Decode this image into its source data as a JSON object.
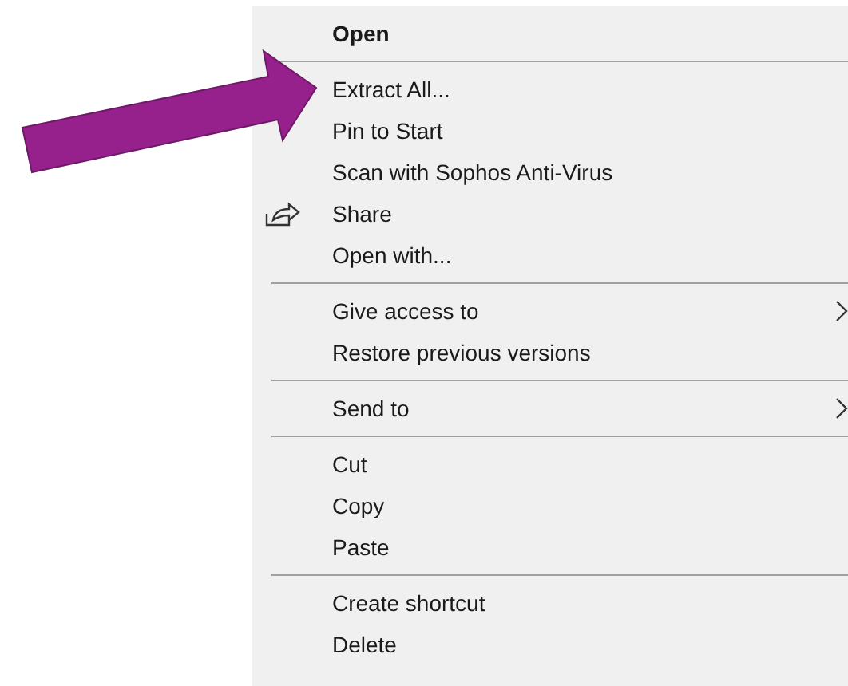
{
  "menu": {
    "items": [
      {
        "kind": "default_bold",
        "label": "Open"
      },
      {
        "kind": "separator"
      },
      {
        "kind": "default",
        "label": "Extract All..."
      },
      {
        "kind": "default",
        "label": "Pin to Start"
      },
      {
        "kind": "default",
        "label": "Scan with Sophos Anti-Virus"
      },
      {
        "kind": "share",
        "label": "Share"
      },
      {
        "kind": "default",
        "label": "Open with..."
      },
      {
        "kind": "separator"
      },
      {
        "kind": "submenu",
        "label": "Give access to"
      },
      {
        "kind": "default",
        "label": "Restore previous versions"
      },
      {
        "kind": "separator"
      },
      {
        "kind": "submenu",
        "label": "Send to"
      },
      {
        "kind": "separator"
      },
      {
        "kind": "default",
        "label": "Cut"
      },
      {
        "kind": "default",
        "label": "Copy"
      },
      {
        "kind": "default",
        "label": "Paste"
      },
      {
        "kind": "separator"
      },
      {
        "kind": "default",
        "label": "Create shortcut"
      },
      {
        "kind": "default",
        "label": "Delete"
      }
    ]
  }
}
